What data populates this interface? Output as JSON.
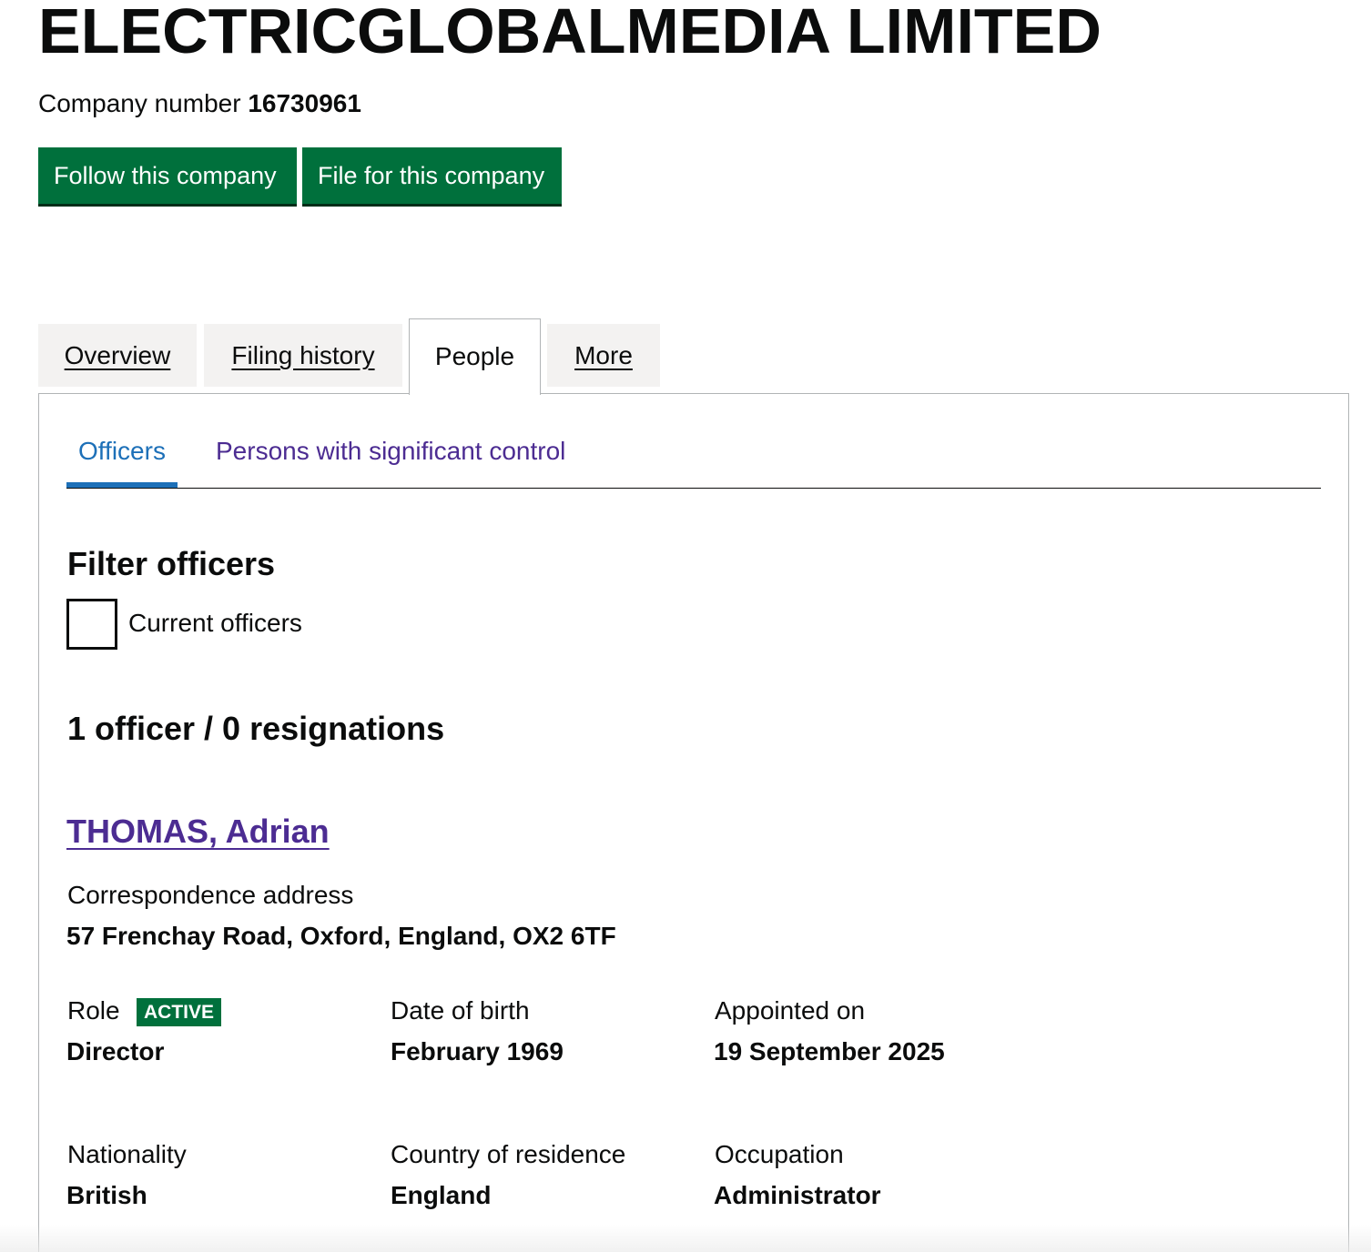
{
  "company": {
    "name": "ELECTRICGLOBALMEDIA LIMITED",
    "number_label": "Company number",
    "number": "16730961"
  },
  "actions": {
    "follow_label": "Follow this company",
    "file_label": "File for this company"
  },
  "tabs": [
    {
      "label": "Overview",
      "active": false
    },
    {
      "label": "Filing history",
      "active": false
    },
    {
      "label": "People",
      "active": true
    },
    {
      "label": "More",
      "active": false
    }
  ],
  "subtabs": [
    {
      "label": "Officers",
      "active": true
    },
    {
      "label": "Persons with significant control",
      "active": false
    }
  ],
  "filter": {
    "heading": "Filter officers",
    "checkbox_label": "Current officers",
    "checked": false
  },
  "summary": "1 officer / 0 resignations",
  "officer": {
    "name": "THOMAS, Adrian",
    "address_label": "Correspondence address",
    "address": "57 Frenchay Road, Oxford, England, OX2 6TF",
    "role_label": "Role",
    "status_badge": "ACTIVE",
    "role": "Director",
    "dob_label": "Date of birth",
    "dob": "February 1969",
    "appointed_label": "Appointed on",
    "appointed": "19 September 2025",
    "nationality_label": "Nationality",
    "nationality": "British",
    "residence_label": "Country of residence",
    "residence": "England",
    "occupation_label": "Occupation",
    "occupation": "Administrator"
  },
  "colors": {
    "button_green": "#00703c",
    "link_purple": "#4c2c92",
    "link_blue": "#1d70b8",
    "tab_grey": "#f3f2f1",
    "border_grey": "#b1b4b6"
  }
}
